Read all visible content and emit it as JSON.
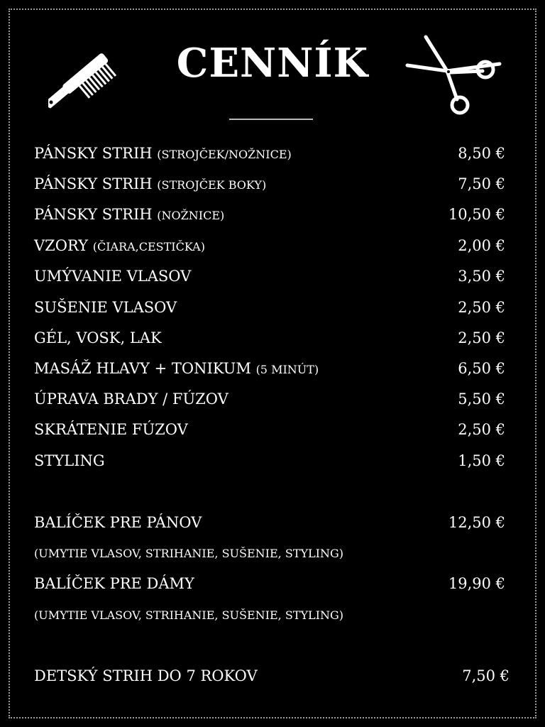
{
  "header": {
    "title": "CENNÍK"
  },
  "items": [
    {
      "name": "PÁNSKY STRIH",
      "note": "(STROJČEK/NOŽNICE)",
      "price": "8,50 €"
    },
    {
      "name": "PÁNSKY STRIH",
      "note": "(STROJČEK BOKY)",
      "price": "7,50 €"
    },
    {
      "name": "PÁNSKY STRIH",
      "note": "(NOŽNICE)",
      "price": "10,50 €"
    },
    {
      "name": "VZORY",
      "note": "(ČIARA,CESTIČKA)",
      "price": "2,00 €"
    },
    {
      "name": "UMÝVANIE VLASOV",
      "note": "",
      "price": "3,50 €"
    },
    {
      "name": "SUŠENIE VLASOV",
      "note": "",
      "price": "2,50 €"
    },
    {
      "name": "GÉL, VOSK, LAK",
      "note": "",
      "price": "2,50 €"
    },
    {
      "name": "MASÁŽ HLAVY + TONIKUM",
      "note": "(5 MINÚT)",
      "price": "6,50 €"
    },
    {
      "name": "ÚPRAVA BRADY / FÚZOV",
      "note": "",
      "price": "5,50 €"
    },
    {
      "name": "SKRÁTENIE FÚZOV",
      "note": "",
      "price": "2,50 €"
    },
    {
      "name": "STYLING",
      "note": "",
      "price": "1,50 €"
    }
  ],
  "packages": [
    {
      "name": "BALÍČEK PRE PÁNOV",
      "price": "12,50 €",
      "details": "(UMYTIE VLASOV, STRIHANIE, SUŠENIE, STYLING)"
    },
    {
      "name": "BALÍČEK PRE DÁMY",
      "price": "19,90 €",
      "details": "(UMYTIE VLASOV, STRIHANIE, SUŠENIE, STYLING)"
    }
  ],
  "kids": {
    "name": "DETSKÝ STRIH DO 7 ROKOV",
    "price": "7,50 €"
  },
  "icons": {
    "left": "comb-icon",
    "right": "scissors-icon"
  }
}
